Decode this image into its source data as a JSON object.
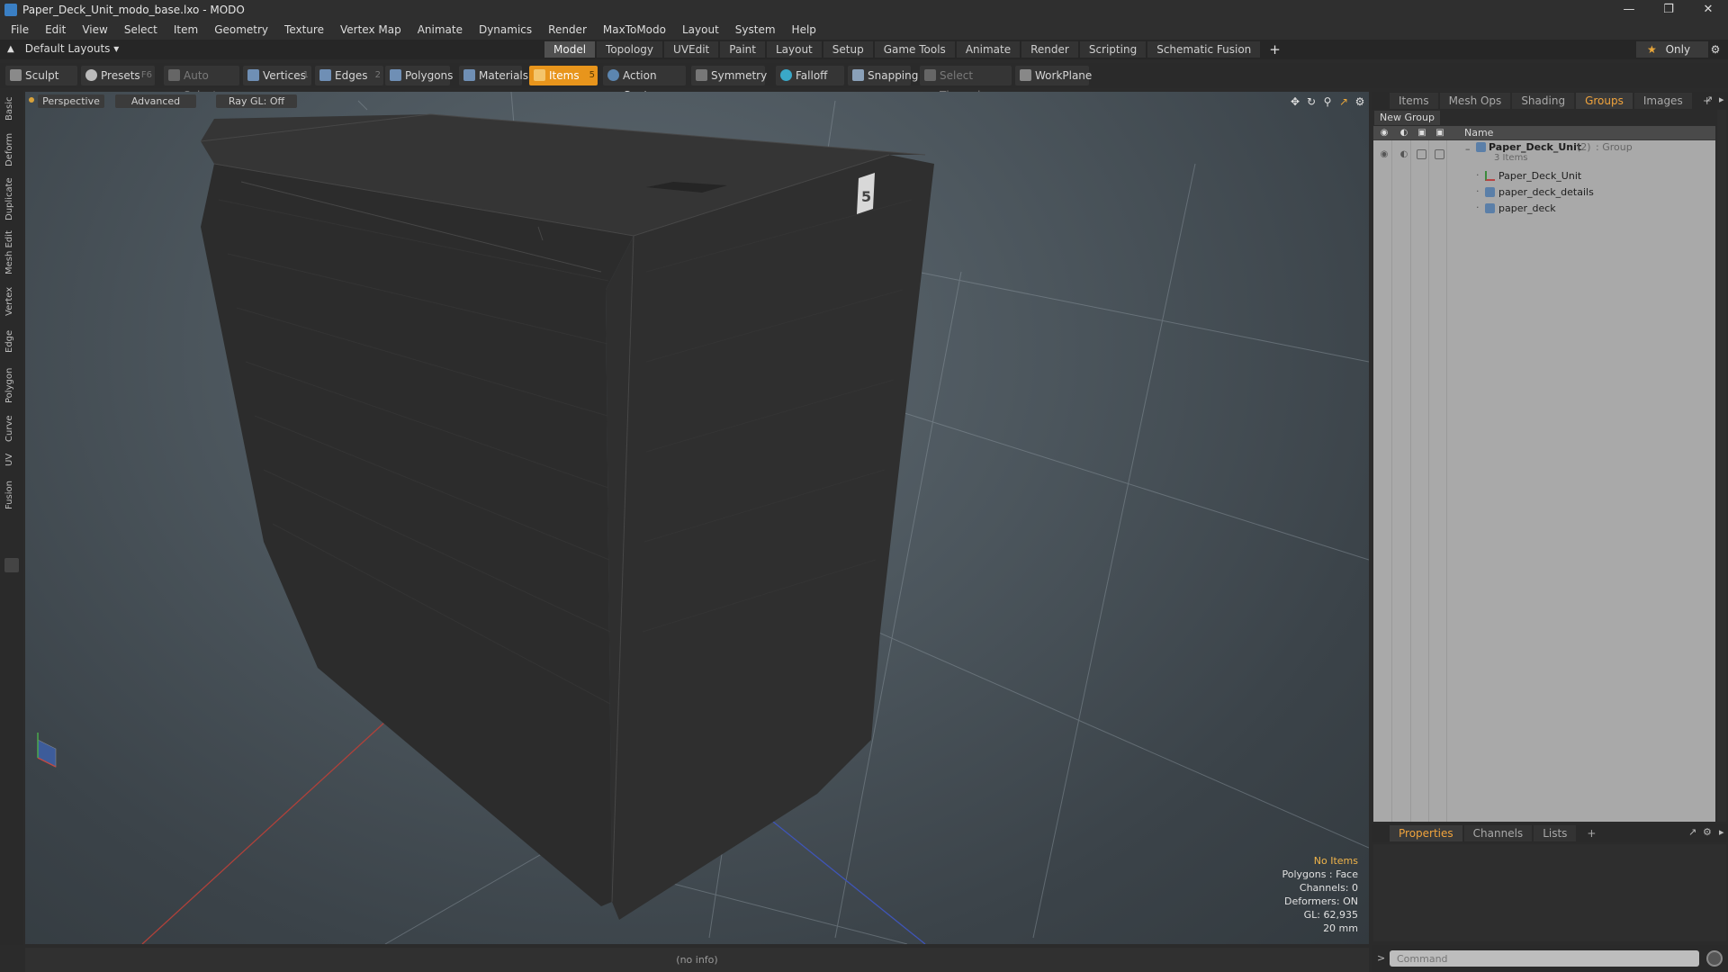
{
  "window": {
    "title": "Paper_Deck_Unit_modo_base.lxo - MODO",
    "minimize": "—",
    "restore": "❐",
    "close": "✕"
  },
  "menu": [
    "File",
    "Edit",
    "View",
    "Select",
    "Item",
    "Geometry",
    "Texture",
    "Vertex Map",
    "Animate",
    "Dynamics",
    "Render",
    "MaxToModo",
    "Layout",
    "System",
    "Help"
  ],
  "layout_bar": {
    "layouts_label": "Default Layouts ▾",
    "tabs": [
      "Model",
      "Topology",
      "UVEdit",
      "Paint",
      "Layout",
      "Setup",
      "Game Tools",
      "Animate",
      "Render",
      "Scripting",
      "Schematic Fusion"
    ],
    "active_tab": "Model",
    "add": "+",
    "only_label": "Only"
  },
  "toolbar": {
    "sculpt": "Sculpt",
    "presets": "Presets",
    "presets_key": "F6",
    "auto_select": "Auto Select",
    "vertices": "Vertices",
    "vertices_key": "1",
    "edges": "Edges",
    "edges_key": "2",
    "polygons": "Polygons",
    "materials": "Materials",
    "items": "Items",
    "items_key": "5",
    "action_center": "Action Center",
    "symmetry": "Symmetry",
    "falloff": "Falloff",
    "snapping": "Snapping",
    "select_through": "Select Through",
    "workplane": "WorkPlane"
  },
  "left_strip": [
    "Basic",
    "Deform",
    "Duplicate",
    "Mesh Edit",
    "Vertex",
    "Edge",
    "Polygon",
    "Curve",
    "UV",
    "Fusion"
  ],
  "viewport": {
    "view": "Perspective",
    "advanced": "Advanced",
    "raygl": "Ray GL: Off",
    "cube_label": "5",
    "info": {
      "items": "No Items",
      "polygons": "Polygons : Face",
      "channels": "Channels: 0",
      "deformers": "Deformers: ON",
      "gl": "GL: 62,935",
      "scale": "20 mm"
    }
  },
  "statusbar": {
    "info": "(no info)"
  },
  "panel_tabs": [
    "Items",
    "Mesh Ops",
    "Shading",
    "Groups",
    "Images"
  ],
  "panel_active": "Groups",
  "groups": {
    "new_group": "New Group",
    "name_col": "Name",
    "group": {
      "name": "Paper_Deck_Unit",
      "count": "(2)",
      "type": ": Group",
      "items_count": "3 Items"
    },
    "children": [
      "Paper_Deck_Unit",
      "paper_deck_details",
      "paper_deck"
    ]
  },
  "props_tabs": [
    "Properties",
    "Channels",
    "Lists"
  ],
  "props_active": "Properties",
  "command": {
    "placeholder": "Command",
    "prompt": ">"
  },
  "colors": {
    "accent": "#e8951c",
    "active_tab_text": "#f0a33c",
    "viewport_bg": "#4c565d",
    "mesh": "#2e2e2e"
  }
}
